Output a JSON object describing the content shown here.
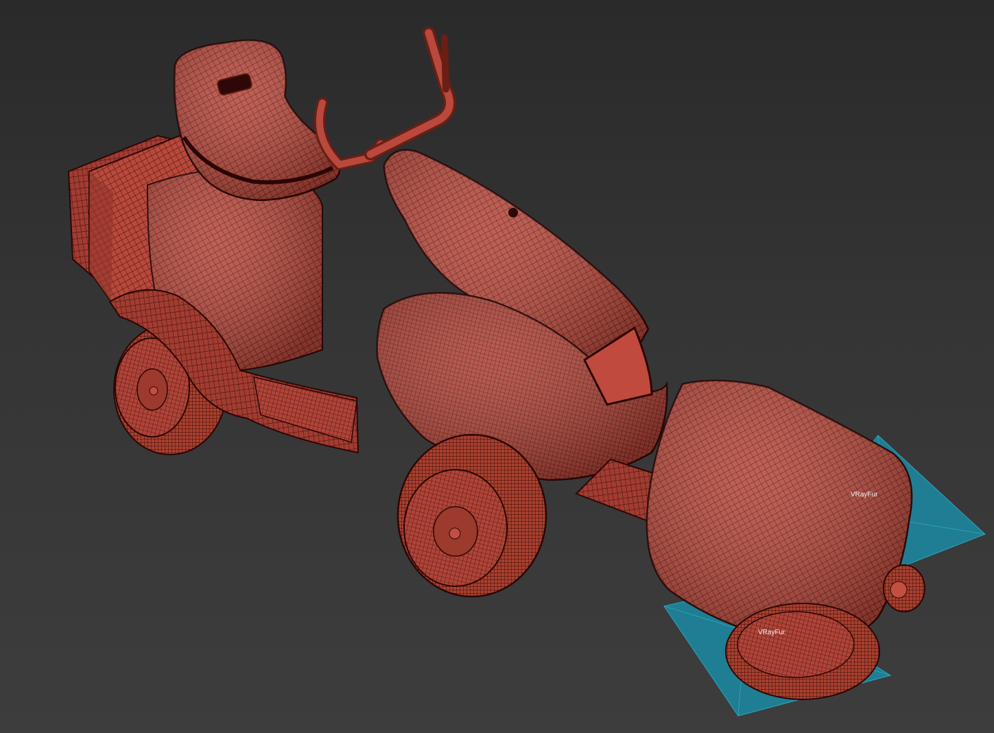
{
  "viewport": {
    "background_top": "#2a2a2a",
    "background_bottom": "#3d3d3d"
  },
  "model": {
    "shaded_color": "#b8493c",
    "wire_color": "#3d0d09",
    "edge_color": "#2b0605"
  },
  "helpers": {
    "color": "#1f7e93",
    "labels": {
      "fur_right": "VRayFur",
      "fur_bottom": "VRayFur"
    }
  }
}
